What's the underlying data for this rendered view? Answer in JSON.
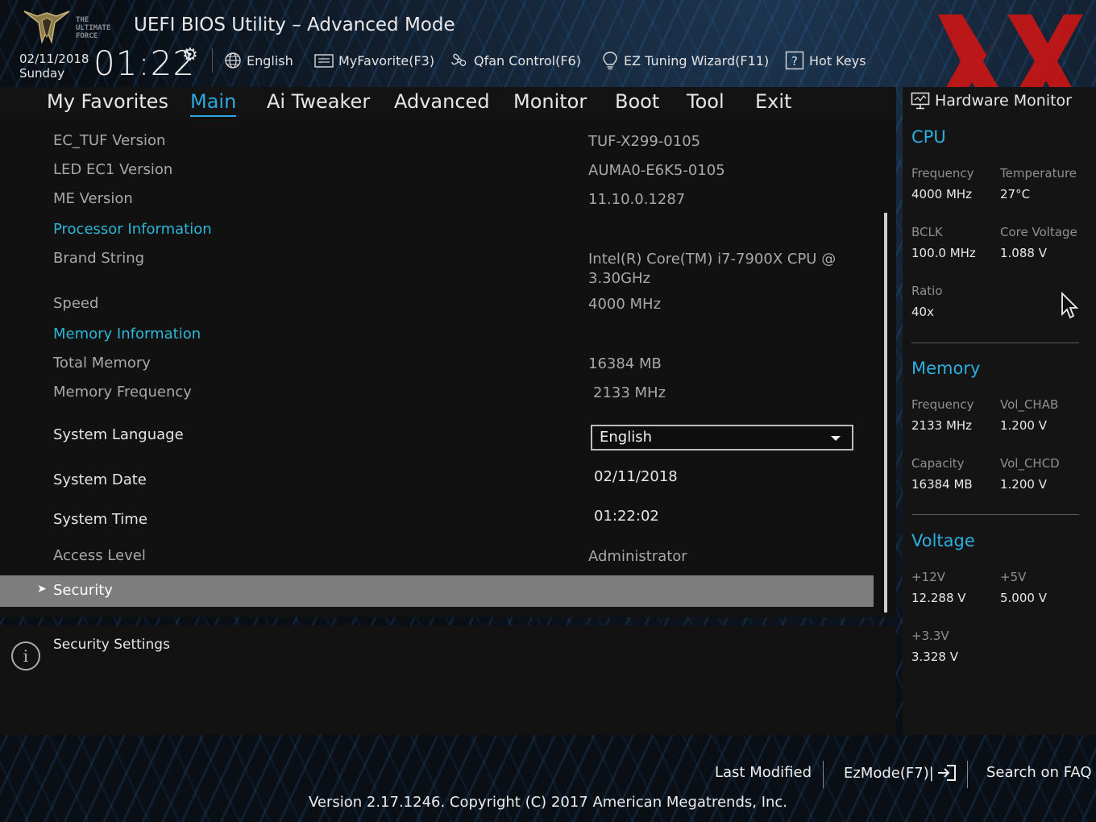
{
  "header": {
    "title": "UEFI BIOS Utility – Advanced Mode",
    "logo_text": [
      "THE",
      "ULTIMATE",
      "FORCE"
    ],
    "date": "02/11/2018",
    "day": "Sunday",
    "time": "01:22",
    "toolbar": [
      {
        "label": "English",
        "icon": "globe-icon"
      },
      {
        "label": "MyFavorite(F3)",
        "icon": "favorite-list-icon"
      },
      {
        "label": "Qfan Control(F6)",
        "icon": "fan-icon"
      },
      {
        "label": "EZ Tuning Wizard(F11)",
        "icon": "lightbulb-icon"
      },
      {
        "label": "Hot Keys",
        "icon": "question-box-icon"
      }
    ]
  },
  "tabs": [
    {
      "label": "My Favorites",
      "active": false
    },
    {
      "label": "Main",
      "active": true
    },
    {
      "label": "Ai Tweaker",
      "active": false
    },
    {
      "label": "Advanced",
      "active": false
    },
    {
      "label": "Monitor",
      "active": false
    },
    {
      "label": "Boot",
      "active": false
    },
    {
      "label": "Tool",
      "active": false
    },
    {
      "label": "Exit",
      "active": false
    }
  ],
  "main": {
    "rows": [
      {
        "label": "EC_TUF Version",
        "value": "TUF-X299-0105"
      },
      {
        "label": "LED EC1 Version",
        "value": "AUMA0-E6K5-0105"
      },
      {
        "label": "ME Version",
        "value": "11.10.0.1287"
      },
      {
        "label": "Processor Information",
        "value": ""
      },
      {
        "label": "Brand String",
        "value": "Intel(R) Core(TM) i7-7900X CPU @",
        "value2": "3.30GHz"
      },
      {
        "label": "Speed",
        "value": "4000 MHz"
      },
      {
        "label": "Memory Information",
        "value": ""
      },
      {
        "label": "Total Memory",
        "value": "16384 MB"
      },
      {
        "label": "Memory Frequency",
        "value": "2133 MHz"
      },
      {
        "label": "System Language",
        "value": "English"
      },
      {
        "label": "System Date",
        "value": "02/11/2018"
      },
      {
        "label": "System Time",
        "value": "01:22:02"
      },
      {
        "label": "Access Level",
        "value": "Administrator"
      }
    ],
    "security": "Security",
    "help_text": "Security Settings"
  },
  "hw_monitor": {
    "title": "Hardware Monitor",
    "cpu": {
      "title": "CPU",
      "frequency_label": "Frequency",
      "frequency": "4000 MHz",
      "temperature_label": "Temperature",
      "temperature": "27°C",
      "bclk_label": "BCLK",
      "bclk": "100.0 MHz",
      "core_voltage_label": "Core Voltage",
      "core_voltage": "1.088 V",
      "ratio_label": "Ratio",
      "ratio": "40x"
    },
    "memory": {
      "title": "Memory",
      "frequency_label": "Frequency",
      "frequency": "2133 MHz",
      "vol_chab_label": "Vol_CHAB",
      "vol_chab": "1.200 V",
      "capacity_label": "Capacity",
      "capacity": "16384 MB",
      "vol_chcd_label": "Vol_CHCD",
      "vol_chcd": "1.200 V"
    },
    "voltage": {
      "title": "Voltage",
      "v12_label": "+12V",
      "v12": "12.288 V",
      "v5_label": "+5V",
      "v5": "5.000 V",
      "v33_label": "+3.3V",
      "v33": "3.328 V"
    }
  },
  "footer": {
    "last_modified": "Last Modified",
    "ezmode": "EzMode(F7)|",
    "search_faq": "Search on FAQ",
    "version": "Version 2.17.1246. Copyright (C) 2017 American Megatrends, Inc."
  },
  "colors": {
    "accent": "#2aa8e0",
    "section": "#2bb7d6",
    "selected_row": "#7d7d7d",
    "watermark": "#d01818"
  }
}
